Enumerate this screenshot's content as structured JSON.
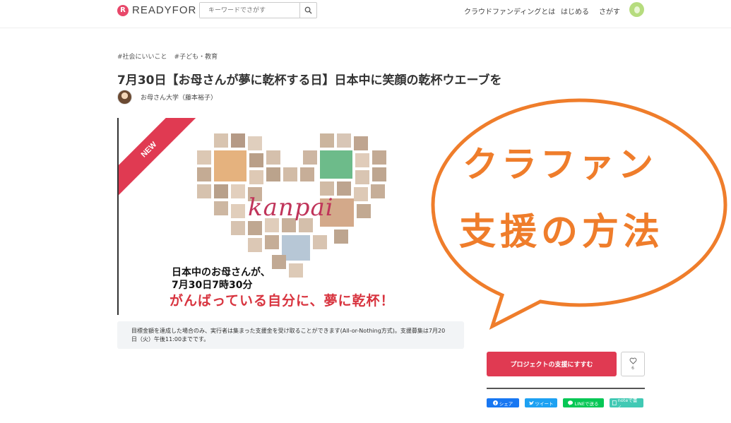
{
  "header": {
    "logo_text": "READYFOR",
    "search_placeholder": "キーワードでさがす",
    "nav": [
      "クラウドファンディングとは",
      "はじめる",
      "さがす"
    ]
  },
  "project": {
    "tags": [
      "#社会にいいこと",
      "#子ども・教育"
    ],
    "title": "7月30日【お母さんが夢に乾杯する日】日本中に笑顔の乾杯ウエーブを",
    "owner_name": "お母さん大学（藤本裕子）"
  },
  "hero": {
    "badge": "NEW",
    "script_text": "kanpai",
    "line1": "日本中のお母さんが、",
    "line2": "7月30日7時30分",
    "line3": "がんばっている自分に、夢に乾杯！"
  },
  "notice": "目標金額を達成した場合のみ、実行者は集まった支援金を受け取ることができます(All-or-Nothing方式)。支援募集は7月20日（火）午後11:00までです。",
  "bubble": {
    "line1": "クラファン",
    "line2": "支援の方法"
  },
  "actions": {
    "support_label": "プロジェクトの支援にすすむ",
    "favorite_count": "6"
  },
  "share": {
    "facebook": "シェア",
    "twitter": "ツイート",
    "line": "LINEで送る",
    "note": "noteで書く"
  },
  "colors": {
    "brand": "#e03a52",
    "bubble_orange": "#ef7d2b",
    "facebook": "#1877f2",
    "twitter": "#1da1f2",
    "line": "#06c755",
    "note": "#41c9b4"
  }
}
